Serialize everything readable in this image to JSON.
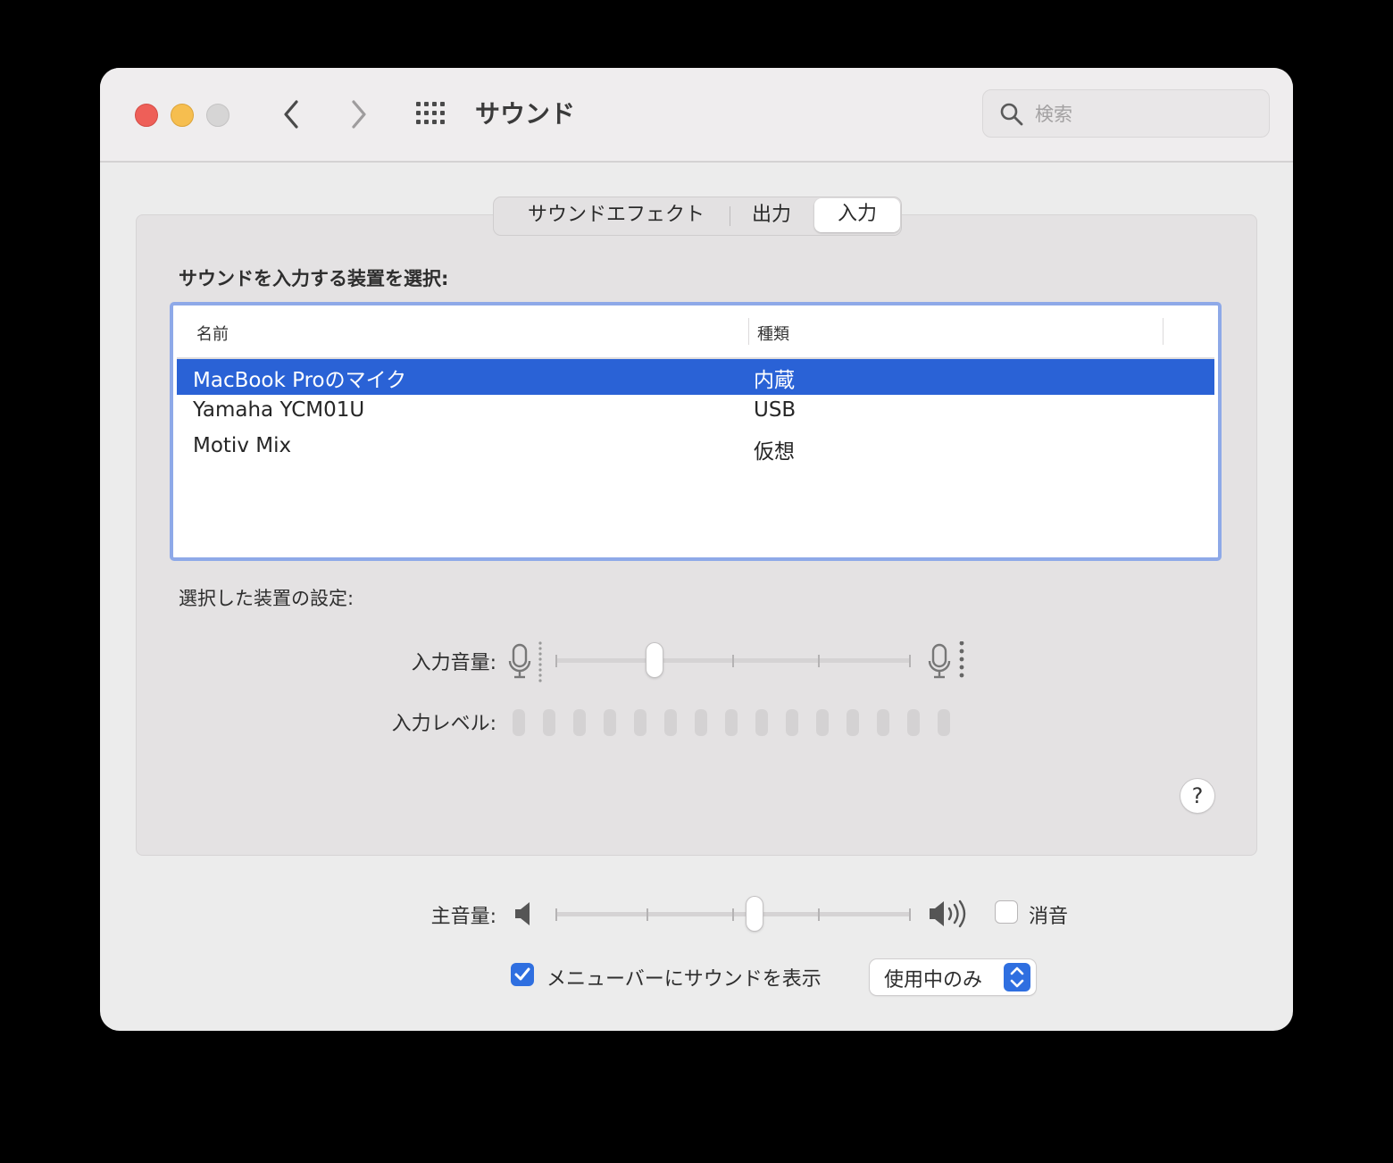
{
  "window": {
    "title": "サウンド",
    "search": {
      "placeholder": "検索",
      "value": ""
    }
  },
  "tabs": [
    {
      "label": "サウンドエフェクト",
      "selected": false
    },
    {
      "label": "出力",
      "selected": false
    },
    {
      "label": "入力",
      "selected": true
    }
  ],
  "input": {
    "section_label": "サウンドを入力する装置を選択:",
    "columns": [
      "名前",
      "種類"
    ],
    "devices": [
      {
        "name": "MacBook Proのマイク",
        "type": "内蔵",
        "selected": true
      },
      {
        "name": "Yamaha YCM01U",
        "type": "USB",
        "selected": false
      },
      {
        "name": "Motiv Mix",
        "type": "仮想",
        "selected": false
      }
    ],
    "settings_label": "選択した装置の設定:",
    "volume_label": "入力音量:",
    "volume_level": 0.28,
    "level_label": "入力レベル:",
    "level_active_count": 0,
    "level_led_count": 15
  },
  "output_volume": {
    "label": "主音量:",
    "level": 0.56,
    "mute_label": "消音",
    "muted": false
  },
  "menubar": {
    "show_label": "メニューバーにサウンドを表示",
    "checked": true,
    "option_value": "使用中のみ"
  },
  "help": {
    "symbol": "?"
  },
  "colors": {
    "selection": "#2a62d6",
    "focus_ring": "#8ea9e8",
    "accent": "#2f6fe0",
    "close": "#ee5f58",
    "minimize": "#f6be4f"
  },
  "icons": [
    "close-icon",
    "minimize-icon",
    "zoom-icon",
    "back-chevron-icon",
    "forward-chevron-icon",
    "grid-icon",
    "search-icon",
    "microphone-icon",
    "speaker-low-icon",
    "speaker-high-icon",
    "checkmark-icon",
    "updown-arrows-icon",
    "help-icon"
  ]
}
